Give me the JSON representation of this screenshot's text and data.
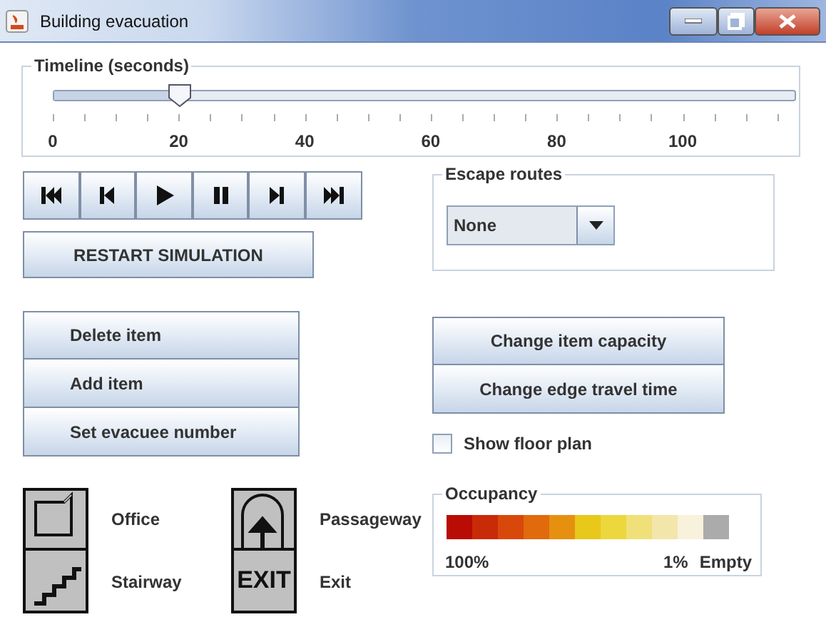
{
  "window": {
    "title": "Building evacuation"
  },
  "timeline": {
    "label": "Timeline (seconds)",
    "level": 0.17,
    "ticks": [
      "0",
      "20",
      "40",
      "60",
      "80",
      "100"
    ]
  },
  "media_buttons": [
    {
      "kind": "first"
    },
    {
      "kind": "prev"
    },
    {
      "kind": "play"
    },
    {
      "kind": "pause"
    },
    {
      "kind": "next"
    },
    {
      "kind": "last"
    }
  ],
  "restart_button": "RESTART SIMULATION",
  "escape_routes": {
    "label": "Escape routes",
    "value": "None"
  },
  "left_buttons": [
    "Delete item",
    "Add item",
    "Set evacuee number"
  ],
  "right_buttons": [
    "Change item capacity",
    "Change edge travel time"
  ],
  "show_floor_plan": {
    "label": "Show floor plan",
    "checked": false
  },
  "legend": [
    {
      "kind": "office",
      "label": "Office"
    },
    {
      "kind": "passageway",
      "label": "Passageway"
    },
    {
      "kind": "stairway",
      "label": "Stairway"
    },
    {
      "kind": "exit",
      "label": "Exit",
      "icon_text": "EXIT"
    }
  ],
  "occupancy": {
    "label": "Occupancy",
    "low": "100%",
    "high": "1%",
    "empty": "Empty"
  }
}
